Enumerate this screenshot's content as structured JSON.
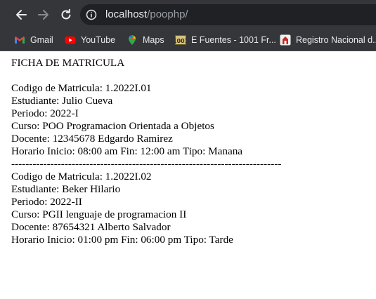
{
  "browser": {
    "url_host": "localhost",
    "url_path": "/poophp/",
    "bookmarks": [
      {
        "label": "Gmail",
        "icon": "gmail-icon"
      },
      {
        "label": "YouTube",
        "icon": "youtube-icon"
      },
      {
        "label": "Maps",
        "icon": "maps-icon"
      },
      {
        "label": "E Fuentes - 1001 Fr...",
        "icon": "fuentes-icon"
      },
      {
        "label": "Registro Nacional d...",
        "icon": "registro-icon"
      }
    ],
    "colors": {
      "toolbar_bg": "#35363a",
      "omnibox_bg": "#202124",
      "text": "#e8eaed",
      "muted": "#9aa0a6"
    }
  },
  "page": {
    "heading": "FICHA DE MATRICULA",
    "records": [
      {
        "codigo": "Codigo de Matricula: 1.2022I.01",
        "estudiante": "Estudiante: Julio Cueva",
        "periodo": "Periodo: 2022-I",
        "curso": "Curso: POO Programacion Orientada a Objetos",
        "docente": "Docente: 12345678 Edgardo Ramirez",
        "horario": "Horario Inicio: 08:00 am Fin: 12:00 am Tipo: Manana"
      },
      {
        "codigo": "Codigo de Matricula: 1.2022I.02",
        "estudiante": "Estudiante: Beker Hilario",
        "periodo": "Periodo: 2022-II",
        "curso": "Curso: PGII lenguaje de programacion II",
        "docente": "Docente: 87654321 Alberto Salvador",
        "horario": "Horario Inicio: 01:00 pm Fin: 06:00 pm Tipo: Tarde"
      }
    ],
    "separator": "----------------------------------------------------------------------------"
  }
}
